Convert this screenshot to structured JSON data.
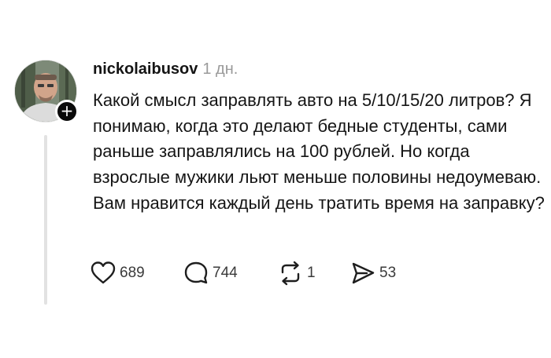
{
  "post": {
    "author": "nickolaibusov",
    "time": "1 дн.",
    "text": "Какой смысл заправлять авто на 5/10/15/20 литров? Я понимаю, когда это делают бедные студенты, сами раньше заправлялись на 100 рублей. Но когда взрослые мужики льют меньше половины недоумеваю. Вам нравится каждый день тратить время на заправку?",
    "follow_symbol": "+",
    "actions": {
      "likes": "689",
      "replies": "744",
      "reposts": "1",
      "shares": "53"
    }
  },
  "icons": {
    "like": "heart-icon",
    "reply": "speech-bubble-icon",
    "repost": "repost-arrows-icon",
    "share": "paper-plane-icon",
    "follow": "plus-icon"
  },
  "colors": {
    "text": "#151515",
    "muted": "#9a9a9a",
    "thread_line": "#e2e2e2",
    "badge": "#0a0a0a"
  }
}
